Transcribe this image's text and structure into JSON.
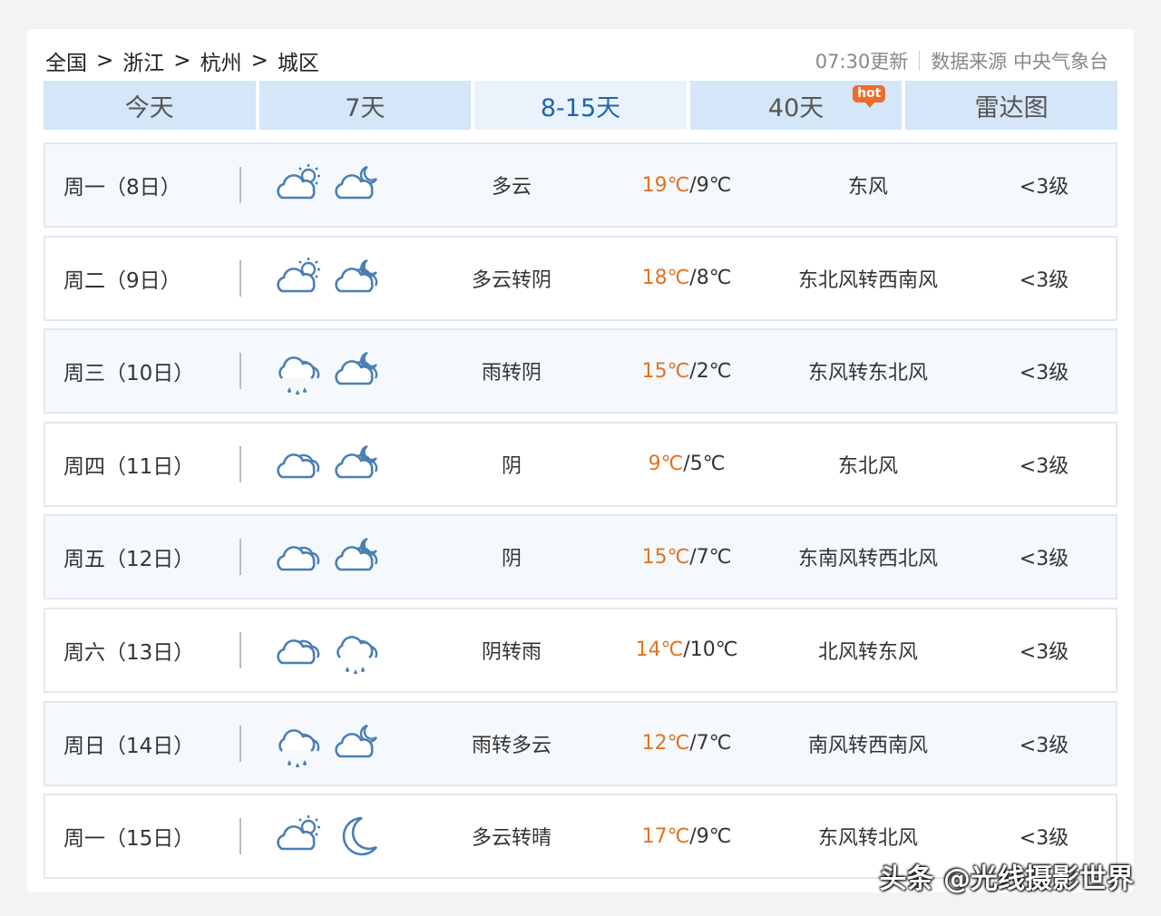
{
  "breadcrumb": [
    "全国",
    "浙江",
    "杭州",
    "城区"
  ],
  "breadcrumb_sep": ">",
  "updated": "07:30更新",
  "source": "数据来源 中央气象台",
  "tabs": [
    {
      "label": "今天",
      "active": false
    },
    {
      "label": "7天",
      "active": false
    },
    {
      "label": "8-15天",
      "active": true
    },
    {
      "label": "40天",
      "active": false,
      "badge": "hot"
    },
    {
      "label": "雷达图",
      "active": false
    }
  ],
  "forecast": [
    {
      "day": "周一（8日）",
      "icons": [
        "cloudy-sun",
        "cloudy-moon"
      ],
      "desc": "多云",
      "high": "19℃",
      "low": "/9℃",
      "wind": "东风",
      "level": "<3级"
    },
    {
      "day": "周二（9日）",
      "icons": [
        "cloudy-sun",
        "overcast-moon"
      ],
      "desc": "多云转阴",
      "high": "18℃",
      "low": "/8℃",
      "wind": "东北风转西南风",
      "level": "<3级"
    },
    {
      "day": "周三（10日）",
      "icons": [
        "rain",
        "overcast-moon"
      ],
      "desc": "雨转阴",
      "high": "15℃",
      "low": "/2℃",
      "wind": "东风转东北风",
      "level": "<3级"
    },
    {
      "day": "周四（11日）",
      "icons": [
        "overcast",
        "overcast-moon"
      ],
      "desc": "阴",
      "high": "9℃",
      "low": "/5℃",
      "wind": "东北风",
      "level": "<3级"
    },
    {
      "day": "周五（12日）",
      "icons": [
        "overcast",
        "overcast-moon"
      ],
      "desc": "阴",
      "high": "15℃",
      "low": "/7℃",
      "wind": "东南风转西北风",
      "level": "<3级"
    },
    {
      "day": "周六（13日）",
      "icons": [
        "overcast",
        "rain"
      ],
      "desc": "阴转雨",
      "high": "14℃",
      "low": "/10℃",
      "wind": "北风转东风",
      "level": "<3级"
    },
    {
      "day": "周日（14日）",
      "icons": [
        "rain",
        "cloudy-moon"
      ],
      "desc": "雨转多云",
      "high": "12℃",
      "low": "/7℃",
      "wind": "南风转西南风",
      "level": "<3级"
    },
    {
      "day": "周一（15日）",
      "icons": [
        "cloudy-sun",
        "clear-moon"
      ],
      "desc": "多云转晴",
      "high": "17℃",
      "low": "/9℃",
      "wind": "东风转北风",
      "level": "<3级"
    }
  ],
  "watermark": "头条 @光线摄影世界",
  "colors": {
    "icon_stroke": "#4a7fb5",
    "temp_high": "#e5711e",
    "tab_bg": "#d4e6f7",
    "tab_active_text": "#1c64b4"
  }
}
